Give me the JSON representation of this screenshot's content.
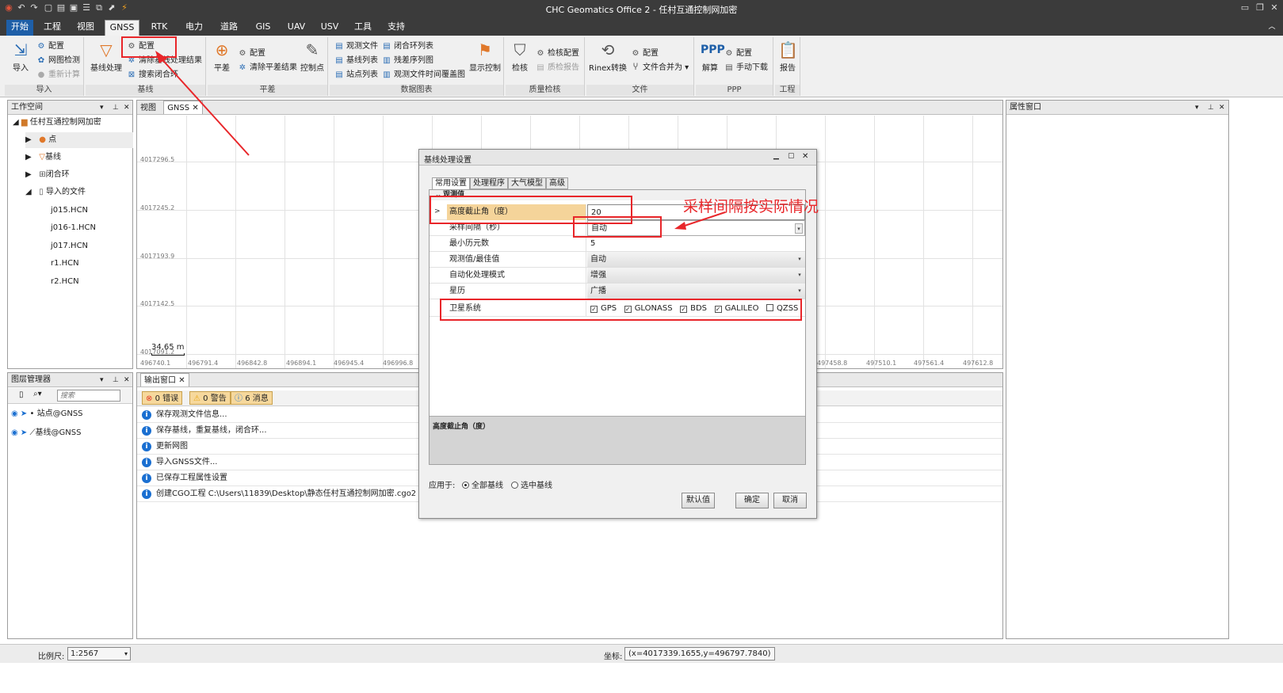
{
  "titlebar": {
    "title": "CHC Geomatics Office 2 - 任村互通控制网加密"
  },
  "menu": [
    "开始",
    "工程",
    "视图",
    "GNSS",
    "RTK",
    "电力",
    "道路",
    "GIS",
    "UAV",
    "USV",
    "工具",
    "支持"
  ],
  "ribbon": {
    "import_group": {
      "label": "导入",
      "import_btn": "导入",
      "config": "配置",
      "network_check": "网图检测",
      "recalc": "重新计算"
    },
    "baseline_group": {
      "label": "基线",
      "baseline_proc": "基线处理",
      "config": "配置",
      "clear_results": "清除基线处理结果",
      "search_loop": "搜索闭合环"
    },
    "adjust_group": {
      "label": "平差",
      "adjust_btn": "平差",
      "config": "配置",
      "clear_adjust": "清除平差结果",
      "control_point": "控制点"
    },
    "data_group": {
      "label": "数据图表",
      "obs_file": "观测文件",
      "baseline_list": "基线列表",
      "station_list": "站点列表",
      "loop_list": "闭合环列表",
      "residual_list": "残差序列图",
      "time_coverage": "观测文件时间覆盖图",
      "display_ctrl": "显示控制"
    },
    "quality_group": {
      "label": "质量检核",
      "check": "检核",
      "check_config": "检核配置",
      "quality_report": "质检报告"
    },
    "file_group": {
      "label": "文件",
      "rinex": "Rinex转换",
      "config": "配置",
      "merge": "文件合并为"
    },
    "ppp_group": {
      "label": "PPP",
      "solve": "解算",
      "config": "配置",
      "manual_download": "手动下载"
    },
    "project_group": {
      "label": "工程",
      "report": "报告"
    }
  },
  "workspace": {
    "title": "工作空间",
    "project": "任村互通控制网加密",
    "items": [
      "点",
      "基线",
      "闭合环",
      "导入的文件"
    ],
    "files": [
      "j015.HCN",
      "j016-1.HCN",
      "j017.HCN",
      "r1.HCN",
      "r2.HCN"
    ]
  },
  "view_tabs": {
    "view": "视图",
    "gnss": "GNSS"
  },
  "map": {
    "y_labels": [
      "4017296.5",
      "4017245.2",
      "4017193.9",
      "4017142.5",
      "4017091.2"
    ],
    "x_labels": [
      "496740.1",
      "496791.4",
      "496842.8",
      "496894.1",
      "496945.4",
      "496996.8",
      "497458.8",
      "497510.1",
      "497561.4",
      "497612.8"
    ],
    "scale_label": "34.65 m"
  },
  "property_window": {
    "title": "属性窗口"
  },
  "layer_manager": {
    "title": "图层管理器",
    "search_placeholder": "搜索",
    "layers": [
      "站点@GNSS",
      "基线@GNSS"
    ]
  },
  "output": {
    "title": "输出窗口",
    "errors": "0 错误",
    "warnings": "0 警告",
    "messages": "6 消息",
    "rows": [
      "保存观测文件信息...",
      "保存基线，重复基线，闭合环...",
      "更新网图",
      "导入GNSS文件...",
      "已保存工程属性设置",
      "创建CGO工程 C:\\Users\\11839\\Desktop\\静态任村互通控制网加密.cgo2 成功"
    ]
  },
  "dialog": {
    "title": "基线处理设置",
    "tabs": [
      "常用设置",
      "处理程序",
      "大气模型",
      "高级"
    ],
    "section": "观测值",
    "rows": [
      {
        "name": "高度截止角（度）",
        "value": "20"
      },
      {
        "name": "采样间隔（秒）",
        "value": "自动"
      },
      {
        "name": "最小历元数",
        "value": "5"
      },
      {
        "name": "观测值/最佳值",
        "value": "自动"
      },
      {
        "name": "自动化处理模式",
        "value": "增强"
      },
      {
        "name": "星历",
        "value": "广播"
      }
    ],
    "satellite_label": "卫星系统",
    "satellites": [
      {
        "name": "GPS",
        "checked": true
      },
      {
        "name": "GLONASS",
        "checked": true
      },
      {
        "name": "BDS",
        "checked": true
      },
      {
        "name": "GALILEO",
        "checked": true
      },
      {
        "name": "QZSS",
        "checked": false
      }
    ],
    "description_title": "高度截止角（度）",
    "apply_label": "应用于:",
    "apply_all": "全部基线",
    "apply_selected": "选中基线",
    "default_btn": "默认值",
    "ok_btn": "确定",
    "cancel_btn": "取消"
  },
  "annotation": {
    "text": "采样间隔按实际情况"
  },
  "status": {
    "scale_label": "比例尺:",
    "scale_value": "1:2567",
    "coord_label": "坐标:",
    "coord_value": "(x=4017339.1655,y=496797.7840)"
  },
  "colors": {
    "accent": "#1e5fa8",
    "annotation_red": "#e8262a",
    "titlebar": "#3b3b3b"
  }
}
